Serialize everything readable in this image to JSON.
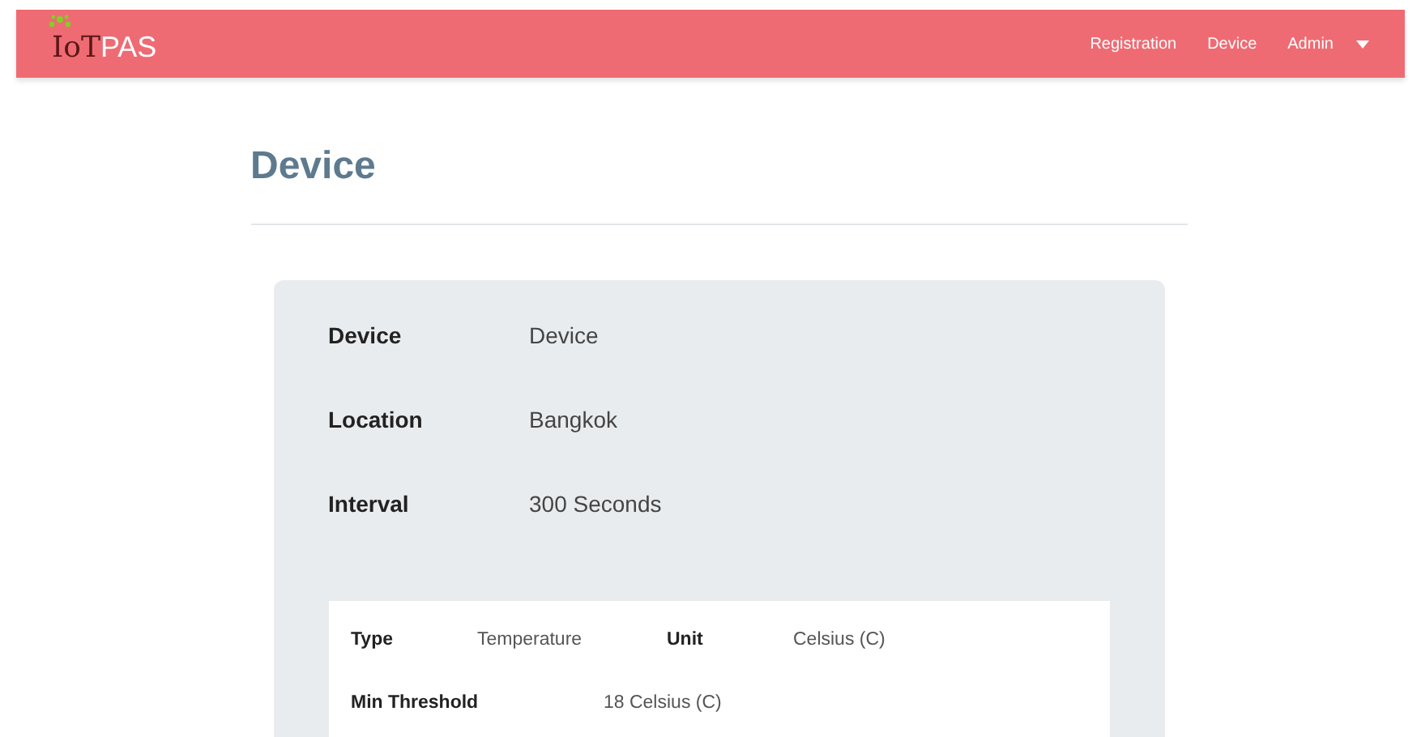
{
  "navbar": {
    "logo": {
      "dark_part": "IoT",
      "light_part": "PAS"
    },
    "links": [
      {
        "label": "Registration"
      },
      {
        "label": "Device"
      },
      {
        "label": "Admin",
        "dropdown": true
      }
    ]
  },
  "page_title": "Device",
  "details": [
    {
      "label": "Device",
      "value": "Device"
    },
    {
      "label": "Location",
      "value": "Bangkok"
    },
    {
      "label": "Interval",
      "value": "300 Seconds"
    }
  ],
  "sensor": {
    "rows": [
      [
        {
          "label": "Type",
          "value": "Temperature"
        },
        {
          "label": "Unit",
          "value": "Celsius (C)"
        }
      ],
      [
        {
          "label": "Min Threshold",
          "value": "18 Celsius (C)"
        }
      ]
    ]
  }
}
